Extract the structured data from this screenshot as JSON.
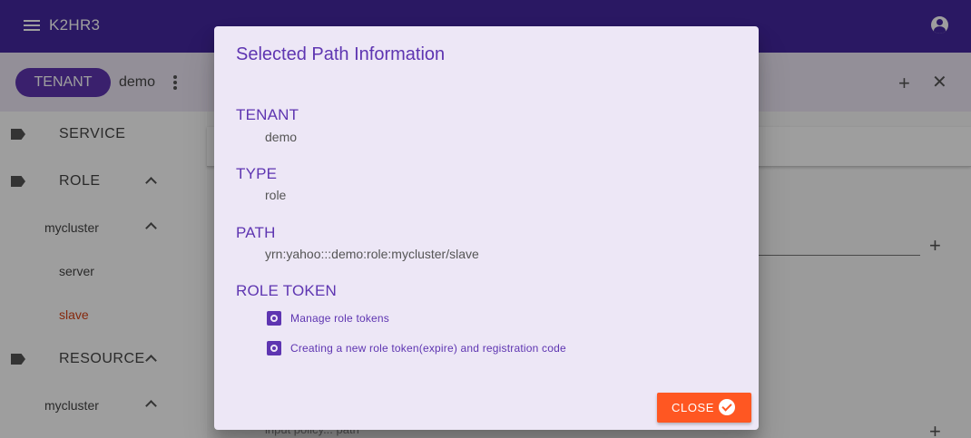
{
  "app": {
    "title": "K2HR3"
  },
  "toolbar": {
    "tenant_chip": "TENANT",
    "tenant_name": "demo",
    "add_symbol": "+",
    "close_symbol": "✕"
  },
  "sidebar": {
    "service_label": "SERVICE",
    "role_label": "ROLE",
    "role_cluster": "mycluster",
    "role_children": [
      "server",
      "slave"
    ],
    "resource_label": "RESOURCE",
    "resource_cluster": "mycluster"
  },
  "main": {
    "hint_text": "input policy... path",
    "plus_symbol": "+"
  },
  "dialog": {
    "title": "Selected Path Information",
    "tenant_heading": "TENANT",
    "tenant_value": "demo",
    "type_heading": "TYPE",
    "type_value": "role",
    "path_heading": "PATH",
    "path_value": "yrn:yahoo:::demo:role:mycluster/slave",
    "role_token_heading": "ROLE TOKEN",
    "links": [
      "Manage role tokens",
      "Creating a new role token(expire) and registration code"
    ],
    "close_label": "CLOSE"
  },
  "colors": {
    "primary": "#4527a0",
    "accent": "#5e35b1",
    "close_button": "#ff5722",
    "selected_item": "#d84315"
  }
}
